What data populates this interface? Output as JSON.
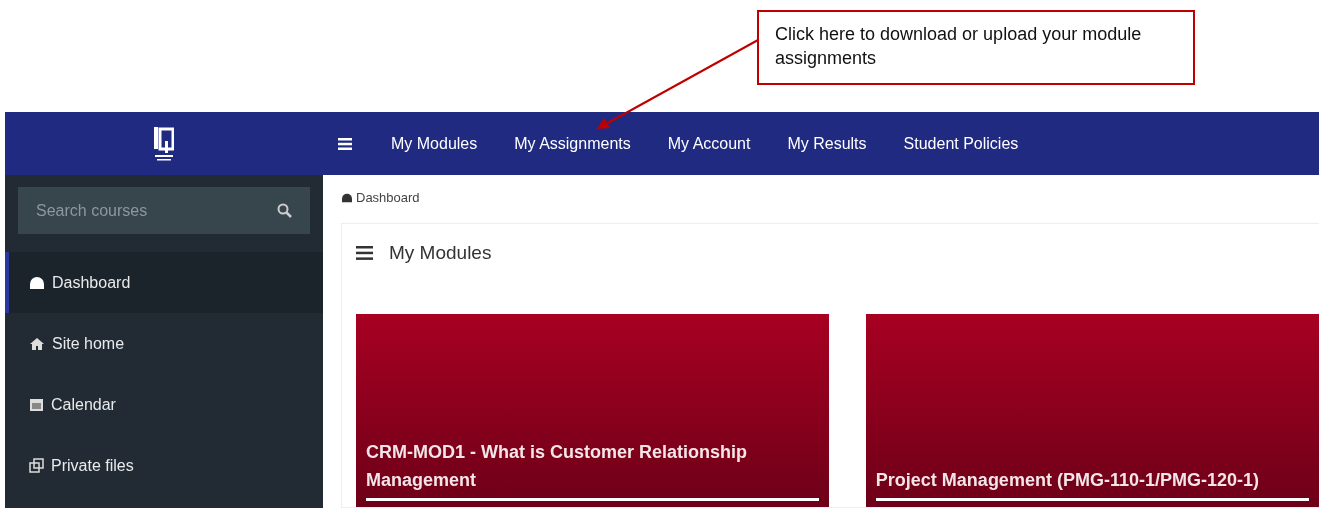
{
  "annotation": {
    "text": "Click here to download or upload your module assignments"
  },
  "header": {
    "nav": [
      {
        "label": "My Modules"
      },
      {
        "label": "My Assignments"
      },
      {
        "label": "My Account"
      },
      {
        "label": "My Results"
      },
      {
        "label": "Student Policies"
      }
    ]
  },
  "sidebar": {
    "search": {
      "placeholder": "Search courses"
    },
    "items": [
      {
        "kind": "dashboard",
        "label": "Dashboard",
        "selected": true
      },
      {
        "kind": "home",
        "label": "Site home",
        "selected": false
      },
      {
        "kind": "calendar",
        "label": "Calendar",
        "selected": false
      },
      {
        "kind": "files",
        "label": "Private files",
        "selected": false
      }
    ]
  },
  "breadcrumb": {
    "label": "Dashboard"
  },
  "panel": {
    "title": "My Modules"
  },
  "modules": [
    {
      "title": "CRM-MOD1 - What is Customer Relationship Management"
    },
    {
      "title": "Project Management (PMG-110-1/PMG-120-1)"
    }
  ]
}
